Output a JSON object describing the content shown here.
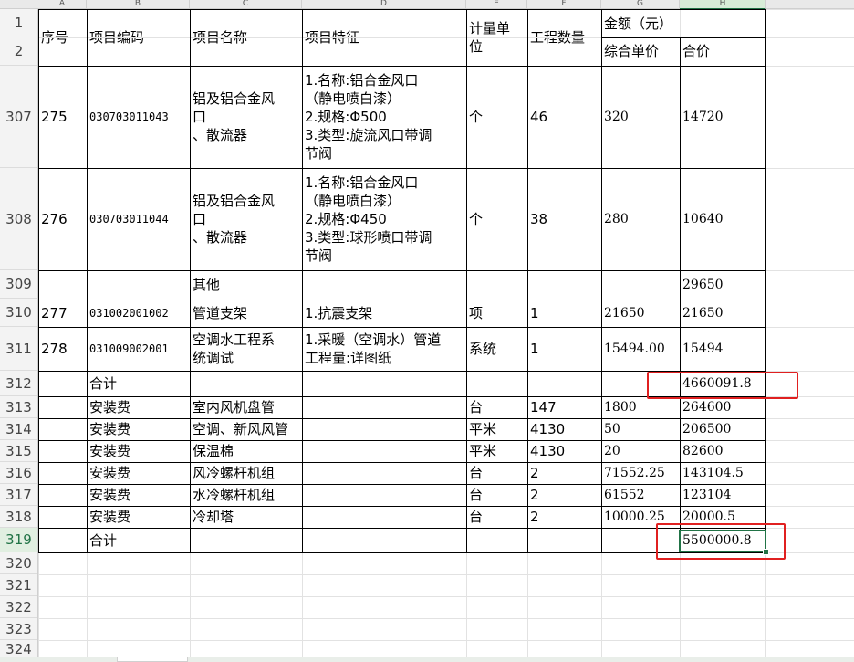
{
  "columns": [
    {
      "letter": "A",
      "selected": false
    },
    {
      "letter": "B",
      "selected": false
    },
    {
      "letter": "C",
      "selected": false
    },
    {
      "letter": "D",
      "selected": false
    },
    {
      "letter": "E",
      "selected": false
    },
    {
      "letter": "F",
      "selected": false
    },
    {
      "letter": "G",
      "selected": false
    },
    {
      "letter": "H",
      "selected": true
    }
  ],
  "row_numbers": [
    "1",
    "2",
    "307",
    "308",
    "309",
    "310",
    "311",
    "312",
    "313",
    "314",
    "315",
    "316",
    "317",
    "318",
    "319",
    "320",
    "321",
    "322",
    "323",
    "324"
  ],
  "selected_row": "319",
  "header": {
    "seq": "序号",
    "code": "项目编码",
    "name": "项目名称",
    "feature": "项目特征",
    "unit": "计量单\n位",
    "qty": "工程数量",
    "amount": "金额（元）",
    "unit_price": "综合单价",
    "total": "合价"
  },
  "rows": [
    {
      "seq": "275",
      "code": "030703011043",
      "name": "铝及铝合金风\n口\n、散流器",
      "feature": "1.名称:铝合金风口\n（静电喷白漆）\n2.规格:Φ500\n3.类型:旋流风口带调\n节阀",
      "unit": "个",
      "qty": "46",
      "price": "320",
      "total": "14720"
    },
    {
      "seq": "276",
      "code": "030703011044",
      "name": "铝及铝合金风\n口\n、散流器",
      "feature": "1.名称:铝合金风口\n（静电喷白漆）\n2.规格:Φ450\n3.类型:球形喷口带调\n节阀",
      "unit": "个",
      "qty": "38",
      "price": "280",
      "total": "10640"
    },
    {
      "seq": "",
      "code": "",
      "name": "其他",
      "feature": "",
      "unit": "",
      "qty": "",
      "price": "",
      "total": "29650"
    },
    {
      "seq": "277",
      "code": "031002001002",
      "name": "管道支架",
      "feature": "1.抗震支架",
      "unit": "项",
      "qty": "1",
      "price": "21650",
      "total": "21650"
    },
    {
      "seq": "278",
      "code": "031009002001",
      "name": "空调水工程系\n统调试",
      "feature": "1.采暖（空调水）管道\n工程量:详图纸",
      "unit": "系统",
      "qty": "1",
      "price": "15494.00",
      "total": "15494"
    },
    {
      "seq": "",
      "code": "合计",
      "name": "",
      "feature": "",
      "unit": "",
      "qty": "",
      "price": "",
      "total": "4660091.8"
    },
    {
      "seq": "",
      "code": "安装费",
      "name": "室内风机盘管",
      "feature": "",
      "unit": "台",
      "qty": "147",
      "price": "1800",
      "total": "264600"
    },
    {
      "seq": "",
      "code": "安装费",
      "name": "空调、新风风管",
      "feature": "",
      "unit": "平米",
      "qty": "4130",
      "price": "50",
      "total": "206500"
    },
    {
      "seq": "",
      "code": "安装费",
      "name": "保温棉",
      "feature": "",
      "unit": "平米",
      "qty": "4130",
      "price": "20",
      "total": "82600"
    },
    {
      "seq": "",
      "code": "安装费",
      "name": "风冷螺杆机组",
      "feature": "",
      "unit": "台",
      "qty": "2",
      "price": "71552.25",
      "total": "143104.5"
    },
    {
      "seq": "",
      "code": "安装费",
      "name": "水冷螺杆机组",
      "feature": "",
      "unit": "台",
      "qty": "2",
      "price": "61552",
      "total": "123104"
    },
    {
      "seq": "",
      "code": "安装费",
      "name": "冷却塔",
      "feature": "",
      "unit": "台",
      "qty": "2",
      "price": "10000.25",
      "total": "20000.5"
    },
    {
      "seq": "",
      "code": "合计",
      "name": "",
      "feature": "",
      "unit": "",
      "qty": "",
      "price": "",
      "total": "5500000.8"
    }
  ],
  "colors": {
    "accent": "#217346",
    "highlight": "#e02020"
  }
}
